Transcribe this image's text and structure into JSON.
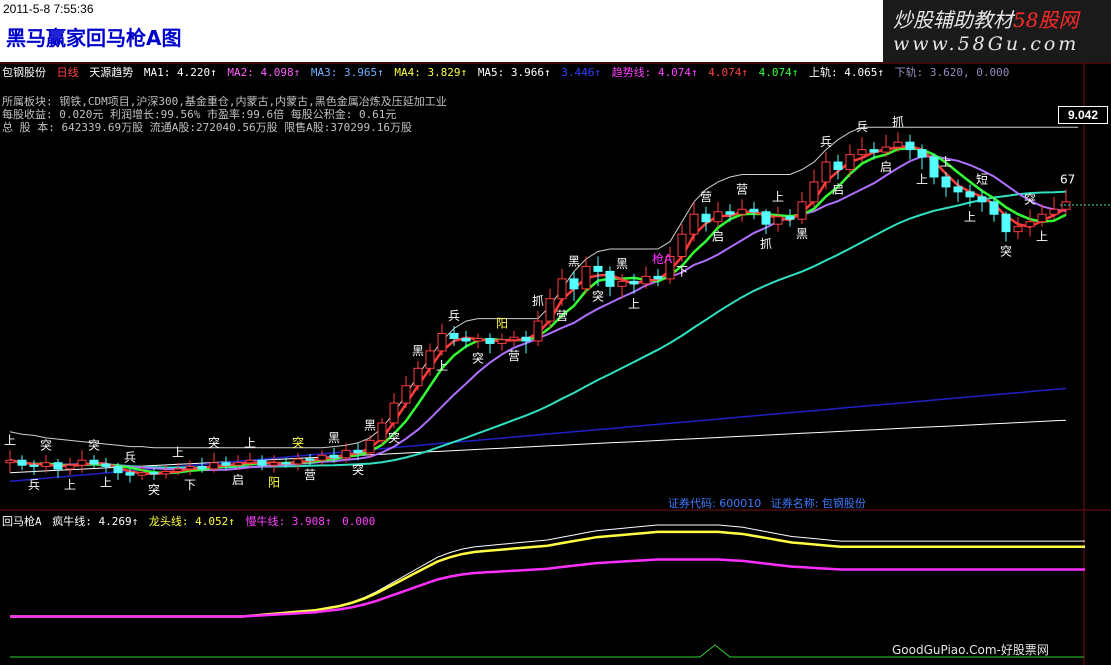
{
  "header": {
    "datetime": "2011-5-8 7:55:36",
    "title": "黑马赢家回马枪A图",
    "brand_line1_a": "炒股辅助教材",
    "brand_line1_b": "58股网",
    "brand_line2": "www.58Gu.com"
  },
  "info": {
    "stock_name": "包钢股份",
    "period": "日线",
    "indicator": "天源趋势",
    "ma1": "MA1: 4.220↑",
    "ma2": "MA2: 4.098↑",
    "ma3": "MA3: 3.965↑",
    "ma4": "MA4: 3.829↑",
    "ma5": "MA5: 3.966↑",
    "ma6": "3.446↑",
    "trend": "趋势线: 4.074↑",
    "v2": "4.074↑",
    "v3": "4.074↑",
    "upper": "上轨: 4.065↑",
    "lower": "下轨: 3.620, 0.000"
  },
  "fundamentals": {
    "line1": "所属板块: 钢铁,CDM项目,沪深300,基金重仓,内蒙古,内蒙古,黑色金属冶炼及压延加工业",
    "line2": "每股收益: 0.020元    利润增长:99.56%    市盈率:99.6倍   每股公积金: 0.61元",
    "line3": "总 股 本: 642339.69万股  流通A股:272040.56万股   限售A股:370299.16万股"
  },
  "price_label": "9.042",
  "security": {
    "code": "证券代码: 600010",
    "name": "证券名称: 包钢股份"
  },
  "sub": {
    "name": "回马枪A",
    "l1": "疯牛线: 4.269↑",
    "l2": "龙头线: 4.052↑",
    "l3": "慢牛线: 3.908↑",
    "l4": "0.000"
  },
  "footer": "GoodGuPiao.Com-好股票网",
  "colors": {
    "up": "#ff3c3c",
    "down": "#54ffff",
    "green": "#33ff33",
    "violet": "#b070ff",
    "cyan_line": "#30e0c0",
    "navy": "#2020c8",
    "white_line": "#e0e0e0",
    "yellow": "#ffff40",
    "magenta": "#ff30ff"
  },
  "markers": [
    {
      "t": "上",
      "c": "#ffffff"
    },
    {
      "t": "兵",
      "c": "#ffffff"
    },
    {
      "t": "突",
      "c": "#ffffff"
    },
    {
      "t": "上",
      "c": "#ffffff"
    },
    {
      "t": "突",
      "c": "#ffffff"
    },
    {
      "t": "上",
      "c": "#ffffff"
    },
    {
      "t": "兵",
      "c": "#ffffff"
    },
    {
      "t": "突",
      "c": "#ffffff"
    },
    {
      "t": "上",
      "c": "#ffffff"
    },
    {
      "t": "下",
      "c": "#ffffff"
    },
    {
      "t": "突",
      "c": "#ffffff"
    },
    {
      "t": "启",
      "c": "#ffffff"
    },
    {
      "t": "上",
      "c": "#ffffff"
    },
    {
      "t": "阳",
      "c": "#ffff40"
    },
    {
      "t": "突",
      "c": "#ffff40"
    },
    {
      "t": "营",
      "c": "#ffffff"
    },
    {
      "t": "黑",
      "c": "#ffffff"
    },
    {
      "t": "突",
      "c": "#ffffff"
    },
    {
      "t": "黑",
      "c": "#ffffff"
    },
    {
      "t": "突",
      "c": "#ffffff"
    },
    {
      "t": "黑",
      "c": "#ffffff"
    },
    {
      "t": "上",
      "c": "#ffffff"
    },
    {
      "t": "兵",
      "c": "#ffffff"
    },
    {
      "t": "突",
      "c": "#ffffff"
    },
    {
      "t": "阳",
      "c": "#ffff40"
    },
    {
      "t": "营",
      "c": "#ffffff"
    },
    {
      "t": "抓",
      "c": "#ffffff"
    },
    {
      "t": "营",
      "c": "#ffffff"
    },
    {
      "t": "黑",
      "c": "#ffffff"
    },
    {
      "t": "突",
      "c": "#ffffff"
    },
    {
      "t": "黑",
      "c": "#ffffff"
    },
    {
      "t": "上",
      "c": "#ffffff"
    },
    {
      "t": "枪A",
      "c": "#ff30ff"
    },
    {
      "t": "下",
      "c": "#ffffff"
    },
    {
      "t": "营",
      "c": "#ffffff"
    },
    {
      "t": "启",
      "c": "#ffffff"
    },
    {
      "t": "营",
      "c": "#ffffff"
    },
    {
      "t": "抓",
      "c": "#ffffff"
    },
    {
      "t": "上",
      "c": "#ffffff"
    },
    {
      "t": "黑",
      "c": "#ffffff"
    },
    {
      "t": "兵",
      "c": "#ffffff"
    },
    {
      "t": "启",
      "c": "#ffffff"
    },
    {
      "t": "兵",
      "c": "#ffffff"
    },
    {
      "t": "启",
      "c": "#ffffff"
    },
    {
      "t": "抓",
      "c": "#ffffff"
    },
    {
      "t": "上",
      "c": "#ffffff"
    },
    {
      "t": "上",
      "c": "#ffffff"
    },
    {
      "t": "上",
      "c": "#ffffff"
    },
    {
      "t": "短",
      "c": "#ffffff"
    },
    {
      "t": "突",
      "c": "#ffffff"
    },
    {
      "t": "突",
      "c": "#ffffff"
    },
    {
      "t": "上",
      "c": "#ffffff"
    },
    {
      "t": "67",
      "c": "#ffffff"
    }
  ],
  "chart_data": {
    "type": "candlestick",
    "candles": [
      {
        "o": 3.3,
        "c": 3.32,
        "h": 3.4,
        "l": 3.22
      },
      {
        "o": 3.32,
        "c": 3.28,
        "h": 3.36,
        "l": 3.24
      },
      {
        "o": 3.28,
        "c": 3.27,
        "h": 3.32,
        "l": 3.2
      },
      {
        "o": 3.27,
        "c": 3.3,
        "h": 3.36,
        "l": 3.22
      },
      {
        "o": 3.3,
        "c": 3.25,
        "h": 3.33,
        "l": 3.18
      },
      {
        "o": 3.25,
        "c": 3.28,
        "h": 3.34,
        "l": 3.2
      },
      {
        "o": 3.28,
        "c": 3.32,
        "h": 3.4,
        "l": 3.22
      },
      {
        "o": 3.32,
        "c": 3.29,
        "h": 3.36,
        "l": 3.26
      },
      {
        "o": 3.29,
        "c": 3.27,
        "h": 3.34,
        "l": 3.22
      },
      {
        "o": 3.27,
        "c": 3.22,
        "h": 3.3,
        "l": 3.16
      },
      {
        "o": 3.22,
        "c": 3.2,
        "h": 3.26,
        "l": 3.14
      },
      {
        "o": 3.2,
        "c": 3.22,
        "h": 3.28,
        "l": 3.16
      },
      {
        "o": 3.22,
        "c": 3.21,
        "h": 3.26,
        "l": 3.16
      },
      {
        "o": 3.21,
        "c": 3.23,
        "h": 3.28,
        "l": 3.17
      },
      {
        "o": 3.23,
        "c": 3.25,
        "h": 3.3,
        "l": 3.2
      },
      {
        "o": 3.25,
        "c": 3.27,
        "h": 3.32,
        "l": 3.2
      },
      {
        "o": 3.27,
        "c": 3.25,
        "h": 3.34,
        "l": 3.22
      },
      {
        "o": 3.25,
        "c": 3.3,
        "h": 3.38,
        "l": 3.22
      },
      {
        "o": 3.3,
        "c": 3.28,
        "h": 3.35,
        "l": 3.24
      },
      {
        "o": 3.28,
        "c": 3.3,
        "h": 3.36,
        "l": 3.24
      },
      {
        "o": 3.3,
        "c": 3.32,
        "h": 3.38,
        "l": 3.26
      },
      {
        "o": 3.32,
        "c": 3.28,
        "h": 3.36,
        "l": 3.24
      },
      {
        "o": 3.28,
        "c": 3.3,
        "h": 3.36,
        "l": 3.22
      },
      {
        "o": 3.3,
        "c": 3.29,
        "h": 3.34,
        "l": 3.26
      },
      {
        "o": 3.29,
        "c": 3.33,
        "h": 3.38,
        "l": 3.24
      },
      {
        "o": 3.33,
        "c": 3.32,
        "h": 3.37,
        "l": 3.28
      },
      {
        "o": 3.32,
        "c": 3.36,
        "h": 3.4,
        "l": 3.28
      },
      {
        "o": 3.36,
        "c": 3.34,
        "h": 3.42,
        "l": 3.3
      },
      {
        "o": 3.34,
        "c": 3.4,
        "h": 3.46,
        "l": 3.3
      },
      {
        "o": 3.4,
        "c": 3.38,
        "h": 3.46,
        "l": 3.32
      },
      {
        "o": 3.38,
        "c": 3.48,
        "h": 3.52,
        "l": 3.34
      },
      {
        "o": 3.48,
        "c": 3.62,
        "h": 3.66,
        "l": 3.44
      },
      {
        "o": 3.62,
        "c": 3.78,
        "h": 3.86,
        "l": 3.58
      },
      {
        "o": 3.78,
        "c": 3.92,
        "h": 4.0,
        "l": 3.74
      },
      {
        "o": 3.92,
        "c": 4.06,
        "h": 4.12,
        "l": 3.88
      },
      {
        "o": 4.06,
        "c": 4.2,
        "h": 4.26,
        "l": 4.0
      },
      {
        "o": 4.2,
        "c": 4.34,
        "h": 4.42,
        "l": 4.16
      },
      {
        "o": 4.34,
        "c": 4.3,
        "h": 4.4,
        "l": 4.24
      },
      {
        "o": 4.3,
        "c": 4.28,
        "h": 4.36,
        "l": 4.22
      },
      {
        "o": 4.28,
        "c": 4.3,
        "h": 4.34,
        "l": 4.22
      },
      {
        "o": 4.3,
        "c": 4.26,
        "h": 4.34,
        "l": 4.18
      },
      {
        "o": 4.26,
        "c": 4.29,
        "h": 4.34,
        "l": 4.2
      },
      {
        "o": 4.29,
        "c": 4.31,
        "h": 4.36,
        "l": 4.24
      },
      {
        "o": 4.31,
        "c": 4.28,
        "h": 4.36,
        "l": 4.18
      },
      {
        "o": 4.28,
        "c": 4.44,
        "h": 4.52,
        "l": 4.24
      },
      {
        "o": 4.44,
        "c": 4.62,
        "h": 4.7,
        "l": 4.38
      },
      {
        "o": 4.62,
        "c": 4.78,
        "h": 4.86,
        "l": 4.56
      },
      {
        "o": 4.78,
        "c": 4.7,
        "h": 4.84,
        "l": 4.6
      },
      {
        "o": 4.7,
        "c": 4.88,
        "h": 4.96,
        "l": 4.66
      },
      {
        "o": 4.88,
        "c": 4.84,
        "h": 4.96,
        "l": 4.72
      },
      {
        "o": 4.84,
        "c": 4.72,
        "h": 4.88,
        "l": 4.64
      },
      {
        "o": 4.72,
        "c": 4.76,
        "h": 4.82,
        "l": 4.62
      },
      {
        "o": 4.76,
        "c": 4.74,
        "h": 4.82,
        "l": 4.66
      },
      {
        "o": 4.74,
        "c": 4.8,
        "h": 4.88,
        "l": 4.7
      },
      {
        "o": 4.8,
        "c": 4.78,
        "h": 4.86,
        "l": 4.72
      },
      {
        "o": 4.78,
        "c": 4.96,
        "h": 5.04,
        "l": 4.74
      },
      {
        "o": 4.96,
        "c": 5.14,
        "h": 5.22,
        "l": 4.92
      },
      {
        "o": 5.14,
        "c": 5.3,
        "h": 5.4,
        "l": 5.08
      },
      {
        "o": 5.3,
        "c": 5.24,
        "h": 5.36,
        "l": 5.16
      },
      {
        "o": 5.24,
        "c": 5.32,
        "h": 5.4,
        "l": 5.2
      },
      {
        "o": 5.32,
        "c": 5.3,
        "h": 5.38,
        "l": 5.24
      },
      {
        "o": 5.3,
        "c": 5.34,
        "h": 5.42,
        "l": 5.24
      },
      {
        "o": 5.34,
        "c": 5.32,
        "h": 5.4,
        "l": 5.26
      },
      {
        "o": 5.32,
        "c": 5.22,
        "h": 5.34,
        "l": 5.14
      },
      {
        "o": 5.22,
        "c": 5.28,
        "h": 5.36,
        "l": 5.16
      },
      {
        "o": 5.28,
        "c": 5.26,
        "h": 5.34,
        "l": 5.2
      },
      {
        "o": 5.26,
        "c": 5.4,
        "h": 5.48,
        "l": 5.22
      },
      {
        "o": 5.4,
        "c": 5.56,
        "h": 5.66,
        "l": 5.36
      },
      {
        "o": 5.56,
        "c": 5.72,
        "h": 5.8,
        "l": 5.5
      },
      {
        "o": 5.72,
        "c": 5.66,
        "h": 5.78,
        "l": 5.58
      },
      {
        "o": 5.66,
        "c": 5.78,
        "h": 5.86,
        "l": 5.6
      },
      {
        "o": 5.78,
        "c": 5.82,
        "h": 5.92,
        "l": 5.72
      },
      {
        "o": 5.82,
        "c": 5.8,
        "h": 5.88,
        "l": 5.74
      },
      {
        "o": 5.8,
        "c": 5.84,
        "h": 5.94,
        "l": 5.76
      },
      {
        "o": 5.84,
        "c": 5.88,
        "h": 5.96,
        "l": 5.8
      },
      {
        "o": 5.88,
        "c": 5.82,
        "h": 5.94,
        "l": 5.74
      },
      {
        "o": 5.82,
        "c": 5.76,
        "h": 5.86,
        "l": 5.66
      },
      {
        "o": 5.76,
        "c": 5.6,
        "h": 5.78,
        "l": 5.54
      },
      {
        "o": 5.6,
        "c": 5.52,
        "h": 5.64,
        "l": 5.44
      },
      {
        "o": 5.52,
        "c": 5.48,
        "h": 5.58,
        "l": 5.4
      },
      {
        "o": 5.48,
        "c": 5.44,
        "h": 5.54,
        "l": 5.36
      },
      {
        "o": 5.44,
        "c": 5.4,
        "h": 5.5,
        "l": 5.32
      },
      {
        "o": 5.4,
        "c": 5.3,
        "h": 5.44,
        "l": 5.24
      },
      {
        "o": 5.3,
        "c": 5.16,
        "h": 5.32,
        "l": 5.08
      },
      {
        "o": 5.16,
        "c": 5.2,
        "h": 5.28,
        "l": 5.1
      },
      {
        "o": 5.2,
        "c": 5.24,
        "h": 5.34,
        "l": 5.12
      },
      {
        "o": 5.24,
        "c": 5.3,
        "h": 5.38,
        "l": 5.2
      },
      {
        "o": 5.3,
        "c": 5.34,
        "h": 5.44,
        "l": 5.26
      },
      {
        "o": 5.34,
        "c": 5.4,
        "h": 5.5,
        "l": 5.3
      }
    ],
    "lines": {
      "white_upper": [
        3.55,
        3.53,
        3.52,
        3.5,
        3.49,
        3.48,
        3.47,
        3.46,
        3.45,
        3.44,
        3.43,
        3.43,
        3.42,
        3.42,
        3.42,
        3.42,
        3.42,
        3.42,
        3.42,
        3.42,
        3.42,
        3.42,
        3.42,
        3.42,
        3.42,
        3.42,
        3.42,
        3.43,
        3.44,
        3.46,
        3.5,
        3.58,
        3.7,
        3.85,
        4.0,
        4.15,
        4.28,
        4.38,
        4.44,
        4.46,
        4.46,
        4.46,
        4.46,
        4.46,
        4.46,
        4.56,
        4.7,
        4.84,
        4.94,
        5.0,
        5.02,
        5.02,
        5.02,
        5.02,
        5.02,
        5.08,
        5.24,
        5.4,
        5.5,
        5.56,
        5.6,
        5.62,
        5.62,
        5.62,
        5.62,
        5.62,
        5.66,
        5.72,
        5.82,
        5.9,
        5.96,
        6.0,
        6.0,
        6.0,
        6.0,
        6.0,
        6.0,
        6.0,
        6.0,
        6.0,
        6.0,
        6.0,
        6.0,
        6.0,
        6.0,
        6.0,
        6.0,
        6.0,
        6.0,
        6.0
      ],
      "sub_white": [
        0.2,
        0.2,
        0.2,
        0.2,
        0.2,
        0.2,
        0.2,
        0.2,
        0.2,
        0.2,
        0.2,
        0.2,
        0.2,
        0.2,
        0.2,
        0.2,
        0.2,
        0.2,
        0.2,
        0.2,
        0.21,
        0.22,
        0.23,
        0.24,
        0.25,
        0.26,
        0.28,
        0.3,
        0.33,
        0.37,
        0.42,
        0.48,
        0.54,
        0.6,
        0.66,
        0.72,
        0.76,
        0.79,
        0.81,
        0.82,
        0.83,
        0.84,
        0.85,
        0.86,
        0.87,
        0.89,
        0.91,
        0.93,
        0.95,
        0.96,
        0.97,
        0.98,
        0.99,
        1.0,
        1.0,
        1.0,
        1.0,
        1.0,
        1.0,
        0.99,
        0.98,
        0.96,
        0.94,
        0.92,
        0.9,
        0.89,
        0.88,
        0.87,
        0.86,
        0.86,
        0.86,
        0.86,
        0.86,
        0.86,
        0.86,
        0.86,
        0.86,
        0.86,
        0.86,
        0.86,
        0.86,
        0.86,
        0.86,
        0.86,
        0.86,
        0.86,
        0.86,
        0.86,
        0.86
      ]
    }
  }
}
